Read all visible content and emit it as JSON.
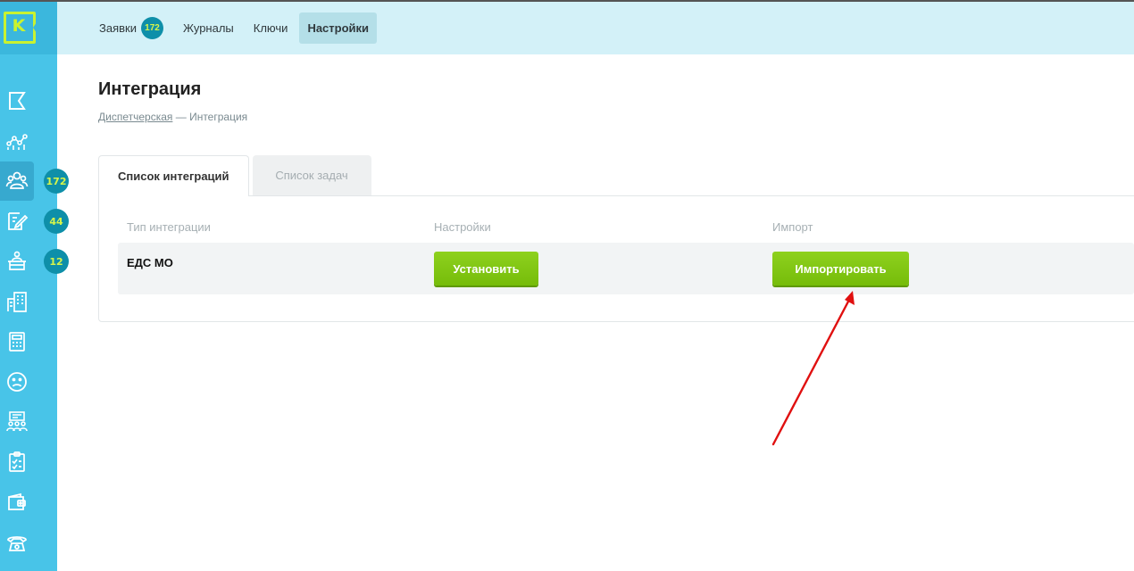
{
  "app": {
    "logo_letter": "K",
    "accent_color": "#48c4e8",
    "badge_color": "#0e8fa9",
    "button_color": "#7fc414"
  },
  "header": {
    "tabs": [
      {
        "label": "Заявки",
        "badge": "172"
      },
      {
        "label": "Журналы"
      },
      {
        "label": "Ключи"
      },
      {
        "label": "Настройки",
        "active": true
      }
    ]
  },
  "sidebar": {
    "items": [
      {
        "icon": "flag-icon"
      },
      {
        "icon": "analytics-icon"
      },
      {
        "icon": "users-group-icon",
        "badge": "172",
        "active": true
      },
      {
        "icon": "edit-document-icon",
        "badge": "44"
      },
      {
        "icon": "reception-desk-icon",
        "badge": "12"
      },
      {
        "icon": "building-icon"
      },
      {
        "icon": "calculator-icon"
      },
      {
        "icon": "sad-face-icon"
      },
      {
        "icon": "meeting-icon"
      },
      {
        "icon": "clipboard-check-icon"
      },
      {
        "icon": "wallet-icon"
      },
      {
        "icon": "phone-icon"
      }
    ]
  },
  "page": {
    "title": "Интеграция",
    "breadcrumb": {
      "link": "Диспетчерская",
      "separator": " — ",
      "current": "Интеграция"
    },
    "tabs": [
      {
        "label": "Список интеграций",
        "active": true
      },
      {
        "label": "Список задач"
      }
    ],
    "table": {
      "columns": [
        "Тип интеграции",
        "Настройки",
        "Импорт"
      ],
      "rows": [
        {
          "type": "ЕДС МО",
          "settings_button": "Установить",
          "import_button": "Импортировать"
        }
      ]
    }
  }
}
